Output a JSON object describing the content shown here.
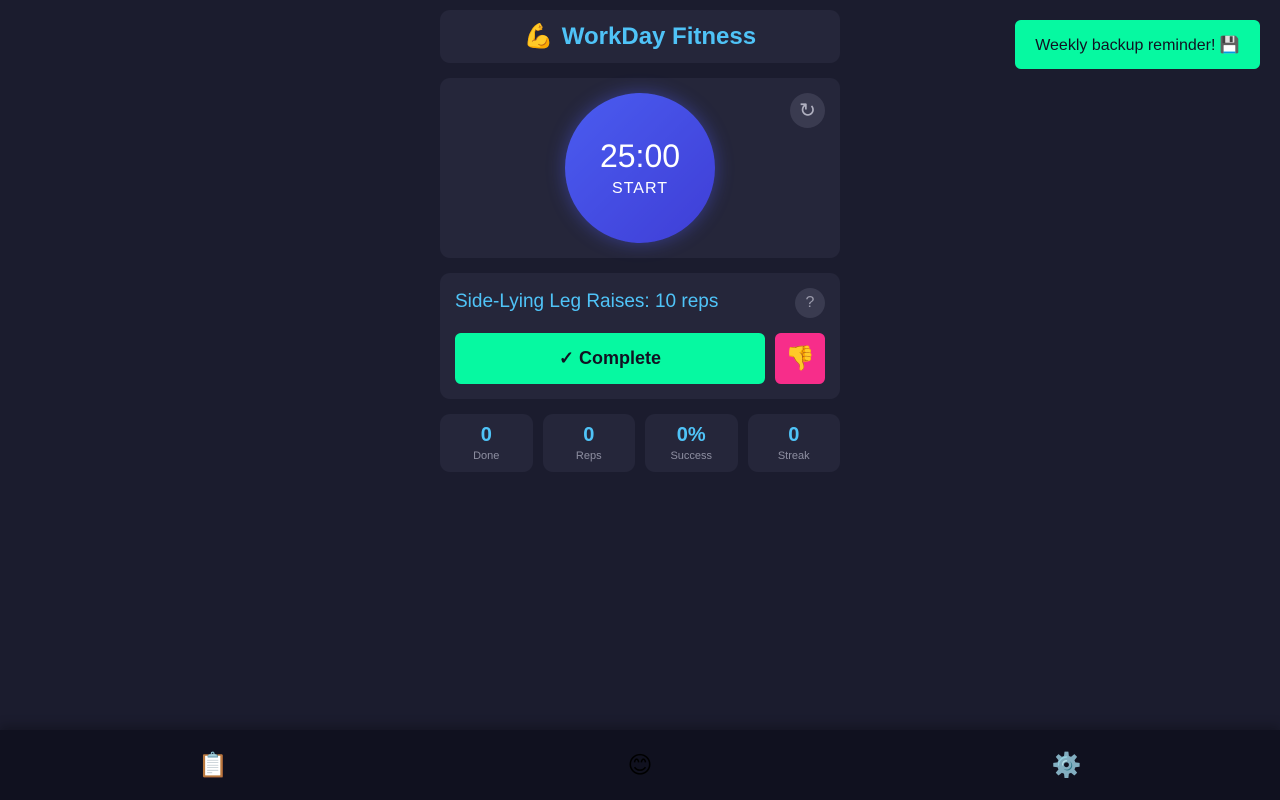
{
  "header": {
    "logo_emoji": "💪",
    "title": "WorkDay Fitness"
  },
  "timer": {
    "time": "25:00",
    "action_label": "START",
    "reset_icon": "↻"
  },
  "exercise": {
    "title": "Side-Lying Leg Raises: 10 reps",
    "help_label": "?",
    "complete_label": "✓ Complete",
    "dislike_icon": "👎"
  },
  "stats": [
    {
      "value": "0",
      "label": "Done"
    },
    {
      "value": "0",
      "label": "Reps"
    },
    {
      "value": "0%",
      "label": "Success"
    },
    {
      "value": "0",
      "label": "Streak"
    }
  ],
  "toast": {
    "message": "Weekly backup reminder! 💾"
  },
  "nav": [
    {
      "icon": "📋",
      "icon_name": "clipboard-icon"
    },
    {
      "icon": "😊",
      "icon_name": "smiley-icon"
    },
    {
      "icon": "⚙️",
      "icon_name": "gear-icon"
    }
  ],
  "colors": {
    "background": "#1b1c2e",
    "card": "#25263a",
    "accent": "#4fc3f7",
    "success": "#06f9a1",
    "danger": "#f72d8a",
    "timer": "#4a5cf0"
  }
}
